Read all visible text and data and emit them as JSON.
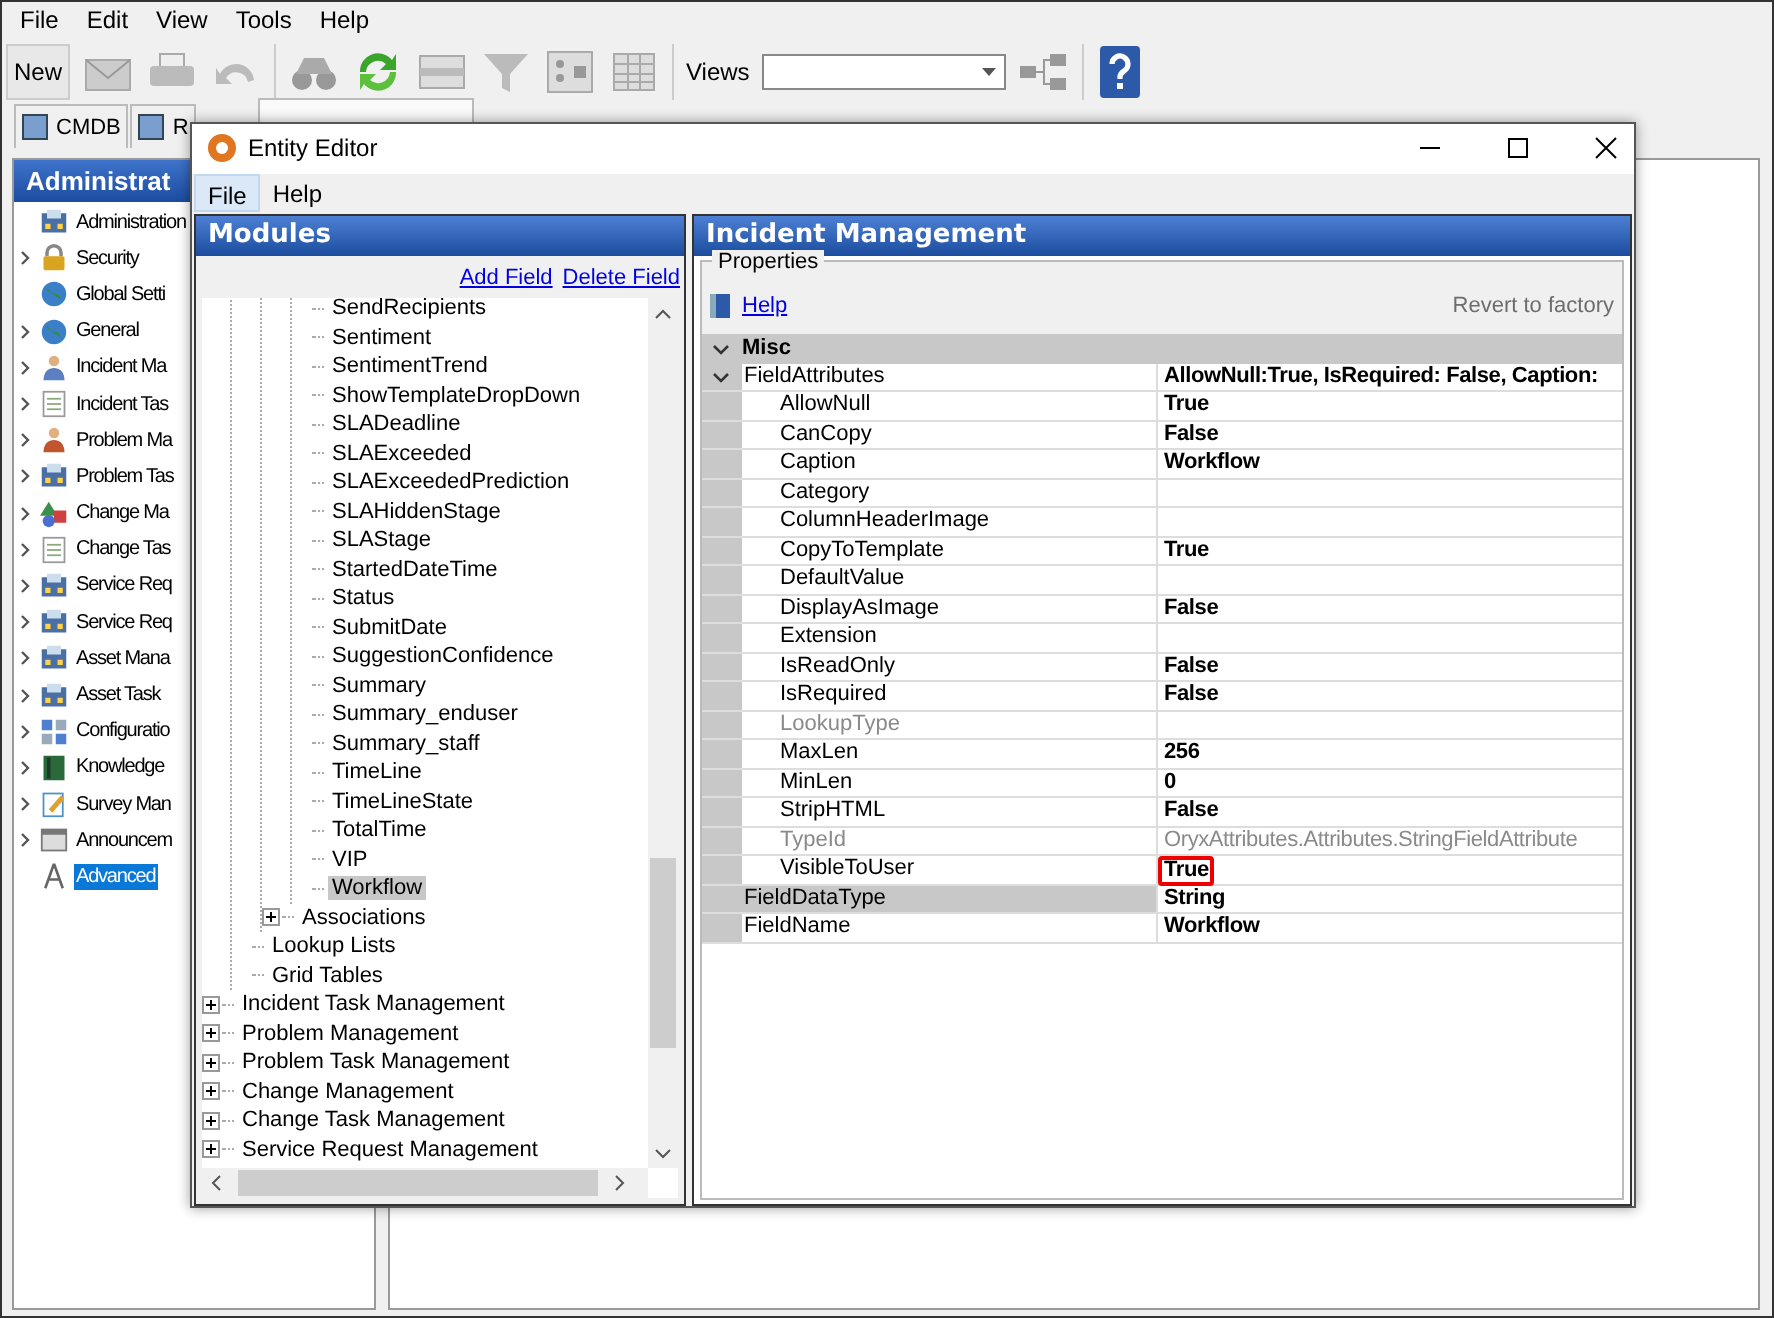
{
  "menu": [
    {
      "label": "File"
    },
    {
      "label": "Edit"
    },
    {
      "label": "View"
    },
    {
      "label": "Tools"
    },
    {
      "label": "Help"
    }
  ],
  "toolbar": {
    "new_button": "New",
    "views_label": "Views"
  },
  "tabs": [
    {
      "label": "CMDB",
      "selected": false
    },
    {
      "label": "R",
      "selected": false
    },
    {
      "selected": true
    }
  ],
  "navigation": {
    "title": "Administrat",
    "items": [
      {
        "label": "Administration",
        "selected": false
      },
      {
        "label": "Security",
        "expanded": false,
        "selected": false
      },
      {
        "label": "Global Setti",
        "selected": false
      },
      {
        "label": "General",
        "expanded": false,
        "selected": false
      },
      {
        "label": "Incident Ma",
        "expanded": false,
        "selected": false
      },
      {
        "label": "Incident Tas",
        "expanded": false,
        "selected": false
      },
      {
        "label": "Problem Ma",
        "expanded": false,
        "selected": false
      },
      {
        "label": "Problem Tas",
        "expanded": false,
        "selected": false
      },
      {
        "label": "Change Ma",
        "expanded": false,
        "selected": false
      },
      {
        "label": "Change Tas",
        "expanded": false,
        "selected": false
      },
      {
        "label": "Service Req",
        "expanded": false,
        "selected": false
      },
      {
        "label": "Service Req",
        "expanded": false,
        "selected": false
      },
      {
        "label": "Asset Mana",
        "expanded": false,
        "selected": false
      },
      {
        "label": "Asset Task",
        "expanded": false,
        "selected": false
      },
      {
        "label": "Configuratio",
        "expanded": false,
        "selected": false
      },
      {
        "label": "Knowledge",
        "expanded": false,
        "selected": false
      },
      {
        "label": "Survey Man",
        "expanded": false,
        "selected": false
      },
      {
        "label": "Announcem",
        "expanded": false,
        "selected": false
      },
      {
        "label": "Advanced",
        "selected": true
      }
    ]
  },
  "dialog": {
    "title": "Entity Editor",
    "menu": [
      {
        "label": "File",
        "selected": true
      },
      {
        "label": "Help",
        "selected": false
      }
    ],
    "modules": {
      "title": "Modules",
      "links": [
        "Add Field",
        "Delete Field"
      ],
      "tree": [
        {
          "children": [
            {
              "children": [
                {
                  "children": [
                    {
                      "label": "SendRecipients",
                      "selected": false
                    },
                    {
                      "label": "Sentiment",
                      "selected": false
                    },
                    {
                      "label": "SentimentTrend",
                      "selected": false
                    },
                    {
                      "label": "ShowTemplateDropDown",
                      "selected": false
                    },
                    {
                      "label": "SLADeadline",
                      "selected": false
                    },
                    {
                      "label": "SLAExceeded",
                      "selected": false
                    },
                    {
                      "label": "SLAExceededPrediction",
                      "selected": false
                    },
                    {
                      "label": "SLAHiddenStage",
                      "selected": false
                    },
                    {
                      "label": "SLAStage",
                      "selected": false
                    },
                    {
                      "label": "StartedDateTime",
                      "selected": false
                    },
                    {
                      "label": "Status",
                      "selected": false
                    },
                    {
                      "label": "SubmitDate",
                      "selected": false
                    },
                    {
                      "label": "SuggestionConfidence",
                      "selected": false
                    },
                    {
                      "label": "Summary",
                      "selected": false
                    },
                    {
                      "label": "Summary_enduser",
                      "selected": false
                    },
                    {
                      "label": "Summary_staff",
                      "selected": false
                    },
                    {
                      "label": "TimeLine",
                      "selected": false
                    },
                    {
                      "label": "TimeLineState",
                      "selected": false
                    },
                    {
                      "label": "TotalTime",
                      "selected": false
                    },
                    {
                      "label": "VIP",
                      "selected": false
                    },
                    {
                      "label": "Workflow",
                      "selected": true
                    }
                  ]
                },
                {
                  "label": "Associations",
                  "expanded": false,
                  "selected": false
                }
              ]
            },
            {
              "label": "Lookup Lists",
              "selected": false
            },
            {
              "label": "Grid Tables",
              "selected": false
            }
          ]
        },
        {
          "label": "Incident Task Management",
          "expanded": false,
          "selected": false
        },
        {
          "label": "Problem Management",
          "expanded": false,
          "selected": false
        },
        {
          "label": "Problem Task Management",
          "expanded": false,
          "selected": false
        },
        {
          "label": "Change Management",
          "expanded": false,
          "selected": false
        },
        {
          "label": "Change Task Management",
          "expanded": false,
          "selected": false
        },
        {
          "label": "Service Request Management",
          "expanded": false,
          "selected": false
        }
      ]
    },
    "properties": {
      "title": "Incident Management",
      "group_label": "Properties",
      "help_link": "Help",
      "revert_button": {
        "label": "Revert to factory",
        "disabled": true
      },
      "categories": [
        {
          "label": "Misc",
          "expanded": true,
          "rows": [
            {
              "name": "FieldAttributes",
              "value": "AllowNull:True, IsRequired: False, Caption:",
              "expanded": true,
              "selected": false,
              "children": [
                {
                  "name": "AllowNull",
                  "value": "True",
                  "disabled": false,
                  "highlighted": false,
                  "selected": false
                },
                {
                  "name": "CanCopy",
                  "value": "False",
                  "disabled": false,
                  "highlighted": false,
                  "selected": false
                },
                {
                  "name": "Caption",
                  "value": "Workflow",
                  "disabled": false,
                  "highlighted": false,
                  "selected": false
                },
                {
                  "name": "Category",
                  "disabled": false,
                  "selected": false
                },
                {
                  "name": "ColumnHeaderImage",
                  "disabled": false,
                  "selected": false
                },
                {
                  "name": "CopyToTemplate",
                  "value": "True",
                  "disabled": false,
                  "highlighted": false,
                  "selected": false
                },
                {
                  "name": "DefaultValue",
                  "disabled": false,
                  "selected": false
                },
                {
                  "name": "DisplayAsImage",
                  "value": "False",
                  "disabled": false,
                  "highlighted": false,
                  "selected": false
                },
                {
                  "name": "Extension",
                  "disabled": false,
                  "selected": false
                },
                {
                  "name": "IsReadOnly",
                  "value": "False",
                  "disabled": false,
                  "highlighted": false,
                  "selected": false
                },
                {
                  "name": "IsRequired",
                  "value": "False",
                  "disabled": false,
                  "highlighted": false,
                  "selected": false
                },
                {
                  "name": "LookupType",
                  "disabled": true,
                  "selected": false
                },
                {
                  "name": "MaxLen",
                  "value": "256",
                  "disabled": false,
                  "highlighted": false,
                  "selected": false
                },
                {
                  "name": "MinLen",
                  "value": "0",
                  "disabled": false,
                  "highlighted": false,
                  "selected": false
                },
                {
                  "name": "StripHTML",
                  "value": "False",
                  "disabled": false,
                  "highlighted": false,
                  "selected": false
                },
                {
                  "name": "TypeId",
                  "value": "OryxAttributes.Attributes.StringFieldAttribute",
                  "disabled": true,
                  "highlighted": false,
                  "selected": false
                },
                {
                  "name": "VisibleToUser",
                  "value": "True",
                  "disabled": false,
                  "highlighted": true,
                  "selected": false
                }
              ]
            },
            {
              "name": "FieldDataType",
              "value": "String",
              "selected": true
            },
            {
              "name": "FieldName",
              "value": "Workflow",
              "selected": false
            }
          ]
        }
      ]
    }
  }
}
